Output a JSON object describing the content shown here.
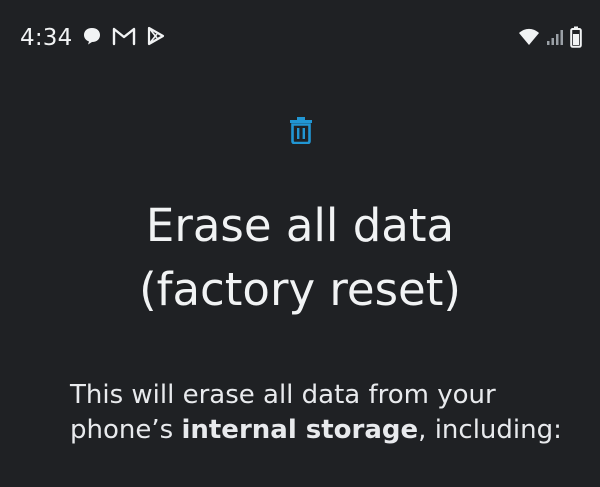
{
  "status_bar": {
    "time": "4:34",
    "notification_icons": [
      "chat-bubble-icon",
      "gmail-icon",
      "play-store-icon"
    ],
    "system_icons": [
      "wifi-icon",
      "signal-icon",
      "battery-icon"
    ]
  },
  "header": {
    "icon": "trash-icon",
    "icon_color": "#2196d3",
    "title_line1": "Erase all data",
    "title_line2": "(factory reset)"
  },
  "body": {
    "text_before": "This will erase all data from your phone’s ",
    "text_bold": "internal storage",
    "text_after": ", including:"
  },
  "colors": {
    "background": "#1f2124",
    "text": "#e8eaed",
    "accent": "#2196d3"
  }
}
